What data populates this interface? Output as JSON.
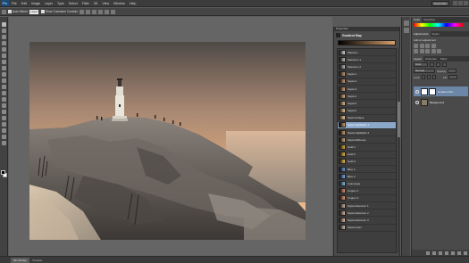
{
  "app": {
    "logo": "Ps"
  },
  "menu": [
    "File",
    "Edit",
    "Image",
    "Layer",
    "Type",
    "Select",
    "Filter",
    "3D",
    "View",
    "Window",
    "Help"
  ],
  "workspace": {
    "label": "Essentials"
  },
  "options": {
    "auto_select_label": "Auto-Select:",
    "auto_select_value": "Layer",
    "show_transform_label": "Show Transform Controls"
  },
  "status": {
    "tab_active": "Mini Bridge",
    "tab_other": "Timeline"
  },
  "properties": {
    "panel_title": "Properties",
    "header_label": "Gradient Map",
    "gradient_colors": [
      "#000000",
      "#d7a06a"
    ],
    "presets": [
      {
        "name": "Platinum",
        "from": "#111111",
        "to": "#e0ddd5"
      },
      {
        "name": "Selenium 1",
        "from": "#0a0a0a",
        "to": "#c9c2bb"
      },
      {
        "name": "Selenium 2",
        "from": "#120d12",
        "to": "#bfb8c0"
      },
      {
        "name": "Sepia 1",
        "from": "#120a04",
        "to": "#c8a27c"
      },
      {
        "name": "Sepia 2",
        "from": "#160c05",
        "to": "#caa07a"
      },
      {
        "name": "Sepia 3",
        "from": "#1a0e06",
        "to": "#d3aa80"
      },
      {
        "name": "Sepia 4",
        "from": "#1a1006",
        "to": "#d6b48c"
      },
      {
        "name": "Sepia 5",
        "from": "#241408",
        "to": "#e1c39c"
      },
      {
        "name": "Sepia 6",
        "from": "#281608",
        "to": "#e6c9a0"
      },
      {
        "name": "Sepia Antique",
        "from": "#3a2410",
        "to": "#e7cfa8"
      },
      {
        "name": "Sepia Highlights 1",
        "from": "#000000",
        "to": "#d7a06a"
      },
      {
        "name": "Sepia Highlights 2",
        "from": "#000000",
        "to": "#d9a877"
      },
      {
        "name": "Sepia Midtones",
        "from": "#000000",
        "to": "#d3b08a"
      },
      {
        "name": "Gold 1",
        "from": "#120c02",
        "to": "#d8b046"
      },
      {
        "name": "Gold 2",
        "from": "#1a1002",
        "to": "#e1b84e"
      },
      {
        "name": "Gold 3",
        "from": "#1c1204",
        "to": "#e8c05c"
      },
      {
        "name": "Blue 1",
        "from": "#020612",
        "to": "#7aa4d8"
      },
      {
        "name": "Blue 2",
        "from": "#02081a",
        "to": "#84b0e2"
      },
      {
        "name": "Cyanotype",
        "from": "#04101e",
        "to": "#8fc0e0"
      },
      {
        "name": "Copper 1",
        "from": "#140602",
        "to": "#d59a7a"
      },
      {
        "name": "Copper 2",
        "from": "#1a0804",
        "to": "#e0a282"
      },
      {
        "name": "Sepia-Selenium 1",
        "from": "#0e0a0e",
        "to": "#d4b8a0"
      },
      {
        "name": "Sepia-Selenium 2",
        "from": "#120c10",
        "to": "#d8bca4"
      },
      {
        "name": "Sepia-Selenium 3",
        "from": "#160e12",
        "to": "#dcc0a8"
      },
      {
        "name": "Sepia-Cyan",
        "from": "#06121a",
        "to": "#d8c0a0"
      }
    ],
    "selected_index": 10
  },
  "dock": {
    "tabs": [
      "Color",
      "Swatches"
    ],
    "adj_tabs": [
      "Adjustments",
      "Styles"
    ],
    "adj_title": "Add an adjustment",
    "layers_tabs": [
      "Layers",
      "Channels",
      "Paths"
    ],
    "kind_label": "Kind",
    "blend_label": "Normal",
    "opacity_label": "Opacity:",
    "lock_label": "Lock:",
    "fill_label": "Fill:",
    "layers": [
      {
        "name": "Gradient Ma...",
        "active": true
      },
      {
        "name": "Background",
        "active": false
      }
    ]
  }
}
